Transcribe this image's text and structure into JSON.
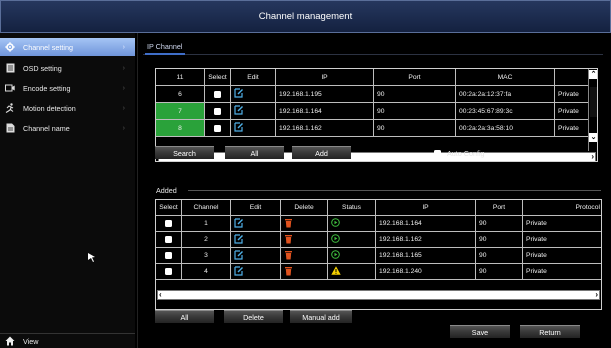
{
  "window": {
    "title": "Channel management"
  },
  "sidebar": {
    "items": [
      {
        "label": "Channel setting",
        "icon": "gear-icon",
        "active": true
      },
      {
        "label": "OSD setting",
        "icon": "document-icon",
        "active": false
      },
      {
        "label": "Encode setting",
        "icon": "video-encode-icon",
        "active": false
      },
      {
        "label": "Motion detection",
        "icon": "running-man-icon",
        "active": false
      },
      {
        "label": "Channel name",
        "icon": "page-icon",
        "active": false
      }
    ],
    "view_label": "View",
    "view_icon": "home-icon"
  },
  "tab": {
    "label": "IP Channel"
  },
  "search_table": {
    "headers": [
      "11",
      "Select",
      "Edit",
      "IP",
      "Port",
      "MAC",
      ""
    ],
    "rows": [
      {
        "no": "6",
        "ip": "192.168.1.195",
        "port": "90",
        "mac": "00:2a:2a:12:37:fa",
        "protocol": "Private",
        "highlight": false
      },
      {
        "no": "7",
        "ip": "192.168.1.164",
        "port": "90",
        "mac": "00:23:45:67:89:3c",
        "protocol": "Private",
        "highlight": true
      },
      {
        "no": "8",
        "ip": "192.168.1.162",
        "port": "90",
        "mac": "00:2a:2a:3a:58:10",
        "protocol": "Private",
        "highlight": true
      }
    ]
  },
  "search_buttons": {
    "search": "Search",
    "all": "All",
    "add": "Add"
  },
  "auto_config": {
    "label": "Auto Config",
    "checked": false
  },
  "added": {
    "label": "Added",
    "headers": [
      "Select",
      "Channel",
      "Edit",
      "Delete",
      "Status",
      "IP",
      "Port",
      "Protocol"
    ],
    "rows": [
      {
        "channel": "1",
        "status": "connected",
        "ip": "192.168.1.164",
        "port": "90",
        "protocol": "Private"
      },
      {
        "channel": "2",
        "status": "connected",
        "ip": "192.168.1.162",
        "port": "90",
        "protocol": "Private"
      },
      {
        "channel": "3",
        "status": "connected",
        "ip": "192.168.1.165",
        "port": "90",
        "protocol": "Private"
      },
      {
        "channel": "4",
        "status": "warning",
        "ip": "192.168.1.240",
        "port": "90",
        "protocol": "Private"
      }
    ]
  },
  "bottom_buttons": {
    "all": "All",
    "delete": "Delete",
    "manual_add": "Manual add",
    "save": "Save",
    "return": "Return"
  },
  "colors": {
    "title_bar": "#1b2a4c",
    "active_item": "#8fb0ea",
    "highlight_row": "#2aa23a",
    "status_ok": "#3fbf3f",
    "status_warn": "#f5d000",
    "delete_icon": "#e0521e"
  }
}
